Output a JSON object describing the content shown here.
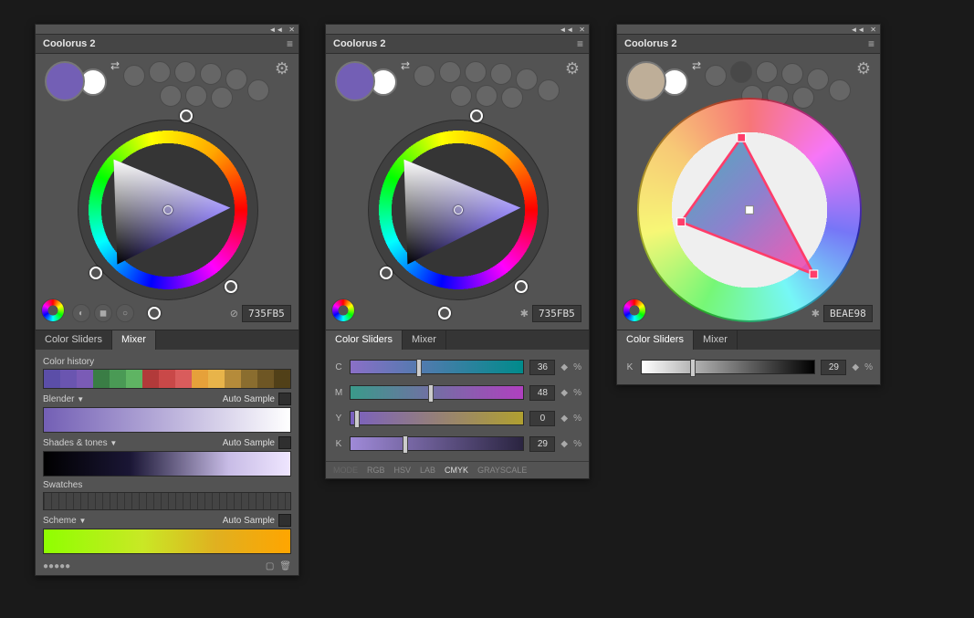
{
  "panels": [
    {
      "title": "Coolorus 2",
      "hex": "735FB5",
      "fg": "#735FB5",
      "tabs": [
        "Color Sliders",
        "Mixer"
      ],
      "activeTab": 1,
      "mixer": {
        "labels": {
          "history": "Color history",
          "blender": "Blender",
          "shades": "Shades & tones",
          "swatches": "Swatches",
          "scheme": "Scheme",
          "auto": "Auto Sample"
        },
        "historyColors": [
          "#5b4ea8",
          "#6a55b0",
          "#7a5bb6",
          "#3a7d45",
          "#4a9a55",
          "#5fb463",
          "#b23a3a",
          "#c94848",
          "#d95c5c",
          "#e6a13a",
          "#e8b44a",
          "#b58b3a",
          "#8a6d2f",
          "#6e5624",
          "#514018"
        ],
        "blenderFrom": "#735FB5",
        "blenderTo": "#ffffff",
        "shadesFrom": "#000000",
        "shadesTo": "#efe6ff",
        "schemeFrom": "#7fff00",
        "schemeTo": "#ffa500"
      }
    },
    {
      "title": "Coolorus 2",
      "hex": "735FB5",
      "fg": "#735FB5",
      "tabs": [
        "Color Sliders",
        "Mixer"
      ],
      "activeTab": 0,
      "sliders": {
        "rows": [
          {
            "label": "C",
            "value": 36,
            "thumb": 38
          },
          {
            "label": "M",
            "value": 48,
            "thumb": 45
          },
          {
            "label": "Y",
            "value": 0,
            "thumb": 2
          },
          {
            "label": "K",
            "value": 29,
            "thumb": 30
          }
        ],
        "modes": [
          "MODE",
          "RGB",
          "HSV",
          "LAB",
          "CMYK",
          "GRAYSCALE"
        ],
        "activeMode": "CMYK"
      }
    },
    {
      "title": "Coolorus 2",
      "hex": "BEAE98",
      "fg": "#BEAE98",
      "tabs": [
        "Color Sliders",
        "Mixer"
      ],
      "activeTab": 0,
      "grayscale": {
        "label": "K",
        "value": 29,
        "thumb": 28
      }
    }
  ]
}
